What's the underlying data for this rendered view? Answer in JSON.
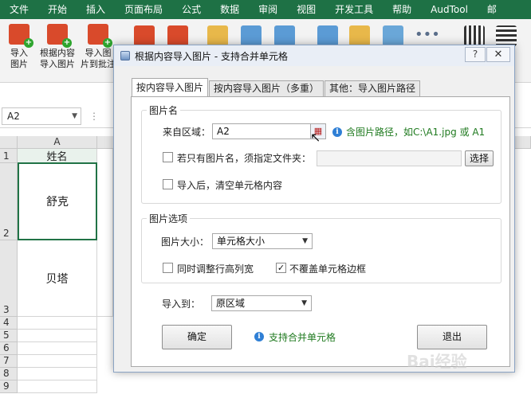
{
  "ribbon_tabs": [
    "文件",
    "开始",
    "插入",
    "页面布局",
    "公式",
    "数据",
    "审阅",
    "视图",
    "开发工具",
    "帮助",
    "AudTool",
    "邮"
  ],
  "ribbon_buttons": [
    {
      "line1": "导入",
      "line2": "图片",
      "color": "#d94a2b"
    },
    {
      "line1": "根据内容",
      "line2": "导入图片",
      "color": "#d94a2b"
    },
    {
      "line1": "导入图",
      "line2": "片到批注",
      "color": "#d94a2b"
    }
  ],
  "namebox": {
    "value": "A2"
  },
  "sheet": {
    "col_header": "A",
    "rows": [
      {
        "num": "1",
        "value": "姓名"
      },
      {
        "num": "2",
        "value": "舒克"
      },
      {
        "num": "3",
        "value": "贝塔"
      },
      {
        "num": "4",
        "value": ""
      },
      {
        "num": "5",
        "value": ""
      },
      {
        "num": "6",
        "value": ""
      },
      {
        "num": "7",
        "value": ""
      },
      {
        "num": "8",
        "value": ""
      },
      {
        "num": "9",
        "value": ""
      }
    ]
  },
  "dialog": {
    "title": "根据内容导入图片 - 支持合并单元格",
    "help": "?",
    "close": "✕",
    "tabs": [
      "按内容导入图片",
      "按内容导入图片（多重）",
      "其他：导入图片路径"
    ],
    "group_image_name": {
      "title": "图片名",
      "source_label": "来自区域：",
      "source_value": "A2",
      "hint": "含图片路径，如C:\\A1.jpg 或 A1",
      "only_name_label": "若只有图片名，须指定文件夹：",
      "folder_value": "",
      "choose_button": "选择",
      "clear_after_label": "导入后，清空单元格内容"
    },
    "group_image_options": {
      "title": "图片选项",
      "size_label": "图片大小：",
      "size_value": "单元格大小",
      "adjust_label": "同时调整行高列宽",
      "no_cover_label": "不覆盖单元格边框",
      "no_cover_checked": "✓"
    },
    "import_to_label": "导入到：",
    "import_to_value": "原区域",
    "ok_button": "确定",
    "merge_hint": "支持合并单元格",
    "exit_button": "退出"
  },
  "colors": {
    "excel_green": "#1e7145",
    "hint_green": "#1f7a1f",
    "info_blue": "#2f7fd5"
  }
}
